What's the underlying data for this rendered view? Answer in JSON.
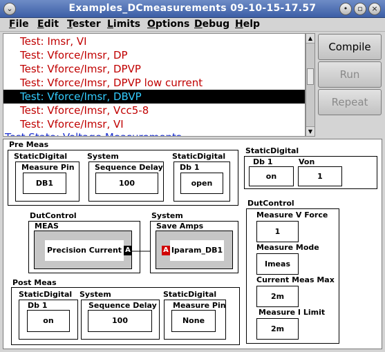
{
  "window": {
    "title": "Examples_DCmeasurements 09-10-15-17.57",
    "menu_icon": "chevron-down-icon",
    "controls": [
      "minimize-icon",
      "maximize-icon",
      "close-icon"
    ]
  },
  "menubar": {
    "items": [
      {
        "label": "File",
        "mnemonic": "F",
        "rest": "ile"
      },
      {
        "label": "Edit",
        "mnemonic": "E",
        "rest": "dit"
      },
      {
        "label": "Tester",
        "mnemonic": "T",
        "rest": "ester"
      },
      {
        "label": "Limits",
        "mnemonic": "L",
        "rest": "imits"
      },
      {
        "label": "Options",
        "mnemonic": "O",
        "rest": "ptions"
      },
      {
        "label": "Debug",
        "mnemonic": "D",
        "rest": "ebug"
      },
      {
        "label": "Help",
        "mnemonic": "H",
        "rest": "elp"
      }
    ]
  },
  "test_list": {
    "items": [
      "Test: Imsr, VI",
      "Test: Vforce/Imsr, DP",
      "Test: Vforce/Imsr, DPVP",
      "Test: Vforce/Imsr, DPVP low current",
      "Test: Vforce/Imsr, DBVP",
      "Test: Vforce/Imsr, Vcc5-8",
      "Test: Vforce/Imsr, VI",
      "Test State: Voltage Measurements"
    ],
    "selected_index": 4
  },
  "buttons": {
    "compile": "Compile",
    "run": "Run",
    "repeat": "Repeat"
  },
  "colors": {
    "title_bar": "#4a6cb4",
    "test_text": "#c00000",
    "selected_bg": "#000000",
    "selected_text": "#33ccff",
    "state_text": "#1a2fd0",
    "port_output": "#000000",
    "port_input": "#d00000"
  },
  "pre_meas": {
    "title": "Pre Meas",
    "groups": [
      {
        "header": "StaticDigital",
        "label": "Measure Pin",
        "value": "DB1"
      },
      {
        "header": "System",
        "label": "Sequence Delay",
        "value": "100"
      },
      {
        "header": "StaticDigital",
        "label": "Db 1",
        "value": "open"
      }
    ]
  },
  "static_digital_right": {
    "header": "StaticDigital",
    "fields": [
      {
        "label": "Db 1",
        "value": "on"
      },
      {
        "label": "Von",
        "value": "1"
      }
    ]
  },
  "dutcontrol_meas": {
    "header": "DutControl",
    "label": "MEAS",
    "value": "Precision Current",
    "port": "A"
  },
  "system_save_amps": {
    "header": "System",
    "label": "Save  Amps",
    "value": "Iparam_DB1",
    "port": "A"
  },
  "dutcontrol_right": {
    "header": "DutControl",
    "fields": [
      {
        "label": "Measure V Force",
        "value": "1"
      },
      {
        "label": "Measure Mode",
        "value": "Imeas"
      },
      {
        "label": "Current Meas Max",
        "value": "2m"
      },
      {
        "label": "Measure I Limit",
        "value": "2m"
      }
    ]
  },
  "post_meas": {
    "title": "Post Meas",
    "groups": [
      {
        "header": "StaticDigital",
        "label": "Db 1",
        "value": "on"
      },
      {
        "header": "System",
        "label": "Sequence Delay",
        "value": "100"
      },
      {
        "header": "StaticDigital",
        "label": "Measure Pin",
        "value": "None"
      }
    ]
  }
}
